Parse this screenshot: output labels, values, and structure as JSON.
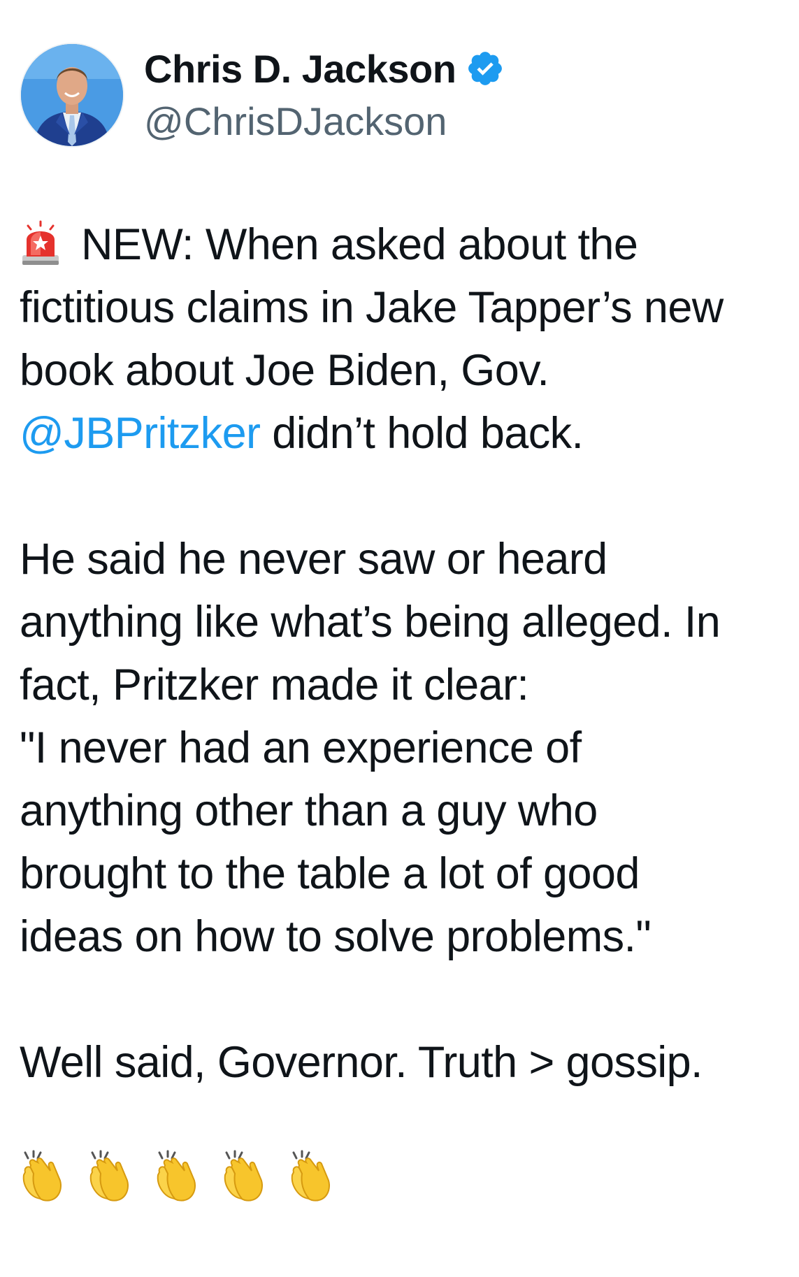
{
  "author": {
    "display_name": "Chris D. Jackson",
    "handle": "@ChrisDJackson",
    "verified": true,
    "avatar_icon": "profile-photo",
    "verified_icon": "verified-badge-icon"
  },
  "tweet": {
    "lead_icon": "rotating-light-emoji",
    "paragraph1": {
      "line1": "NEW: When asked about the",
      "line2": "fictitious claims in Jake Tapper’s new",
      "line3": "book about Joe Biden, Gov.",
      "mention": "@JBPritzker",
      "line4_rest": " didn’t hold back."
    },
    "paragraph2": {
      "line1": "He said he never saw or heard",
      "line2": "anything like what’s being alleged. In",
      "line3": "fact, Pritzker made it clear:",
      "line4": "\"I never had an experience of",
      "line5": "anything other than a guy who",
      "line6": "brought to the table a lot of good",
      "line7": "ideas on how to solve problems.\""
    },
    "paragraph3": {
      "line1": "Well said, Governor. Truth > gossip."
    },
    "trailing_emoji": [
      "clapping-hands-emoji",
      "clapping-hands-emoji",
      "clapping-hands-emoji",
      "clapping-hands-emoji",
      "clapping-hands-emoji"
    ]
  },
  "colors": {
    "text": "#0f1419",
    "secondary": "#536471",
    "link": "#1d9bf0",
    "verified": "#1d9bf0"
  }
}
